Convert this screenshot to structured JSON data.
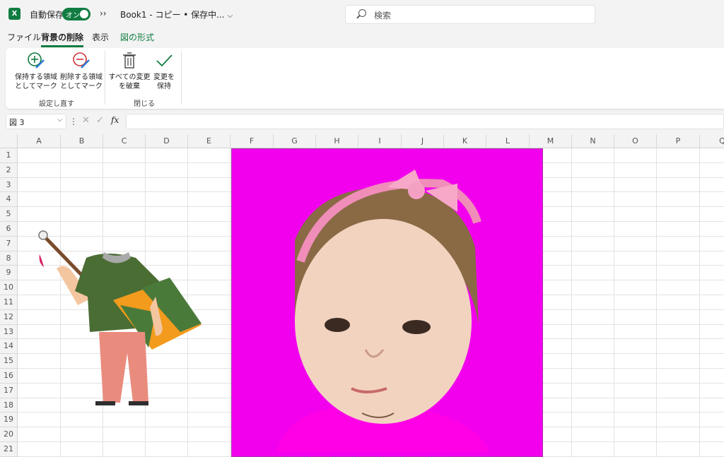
{
  "titlebar": {
    "logo": "X",
    "autosave_label": "自動保存",
    "toggle_label": "オン",
    "more": "››",
    "doc_title": "Book1 - コピー • 保存中...",
    "search_placeholder": "検索"
  },
  "tabs": [
    "ファイル",
    "背景の削除",
    "表示",
    "図の形式"
  ],
  "ribbon": {
    "keep_btn": [
      "保持する領域",
      "としてマーク"
    ],
    "remove_btn": [
      "削除する領域",
      "としてマーク"
    ],
    "group1_label": "設定し直す",
    "discard_btn": [
      "すべての変更",
      "を破棄"
    ],
    "keep_changes_btn": [
      "変更を",
      "保持"
    ],
    "group2_label": "閉じる"
  },
  "formula_bar": {
    "name_box": "図 3",
    "fx": "fx"
  },
  "columns": [
    "A",
    "B",
    "C",
    "D",
    "E",
    "F",
    "G",
    "H",
    "I",
    "J",
    "K",
    "L",
    "M",
    "N",
    "O",
    "P",
    "Q"
  ],
  "rows": [
    "1",
    "2",
    "3",
    "4",
    "5",
    "6",
    "7",
    "8",
    "9",
    "10",
    "11",
    "12",
    "13",
    "14",
    "15",
    "16",
    "17",
    "18",
    "19",
    "20",
    "21"
  ],
  "colors": {
    "accent": "#107c41",
    "removed_area": "#ff00ff"
  }
}
